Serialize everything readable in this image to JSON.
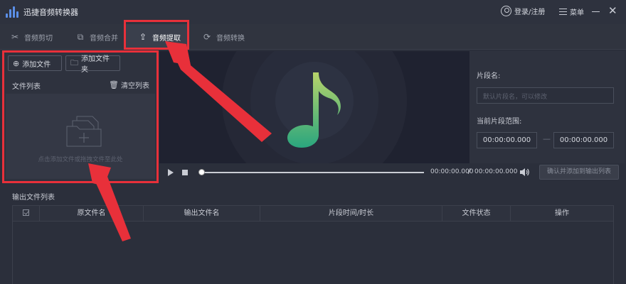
{
  "app": {
    "title": "迅捷音频转换器"
  },
  "titlebar": {
    "login_label": "登录/注册",
    "menu_label": "菜单",
    "minimize_icon": "minimize-icon",
    "close_icon": "close-icon"
  },
  "tabs": [
    {
      "label": "音频剪切",
      "icon": "scissors-icon",
      "active": false
    },
    {
      "label": "音频合并",
      "icon": "merge-icon",
      "active": false
    },
    {
      "label": "音频提取",
      "icon": "export-icon",
      "active": true
    },
    {
      "label": "音频转换",
      "icon": "convert-icon",
      "active": false
    }
  ],
  "left_panel": {
    "add_file_label": "添加文件",
    "add_folder_label": "添加文件夹",
    "file_list_label": "文件列表",
    "clear_list_label": "清空列表",
    "drop_hint": "点击添加文件或拖拽文件至此处"
  },
  "player": {
    "current_time": "00:00:00.000",
    "separator": "/",
    "total_time": "00:00:00.000",
    "confirm_label": "确认并添加到输出列表",
    "progress": 0
  },
  "right_panel": {
    "segment_name_label": "片段名:",
    "segment_name_placeholder": "默认片段名，可以修改",
    "range_label": "当前片段范围:",
    "range_start": "00:00:00.000",
    "range_dash": "—",
    "range_end": "00:00:00.000"
  },
  "output": {
    "title": "输出文件列表",
    "columns": [
      "原文件名",
      "输出文件名",
      "片段时间/时长",
      "文件状态",
      "操作"
    ]
  },
  "colors": {
    "accent": "#e8303a",
    "note_gradient_top": "#b7d36a",
    "note_gradient_bottom": "#2aa67e",
    "background": "#2b2f3b"
  }
}
